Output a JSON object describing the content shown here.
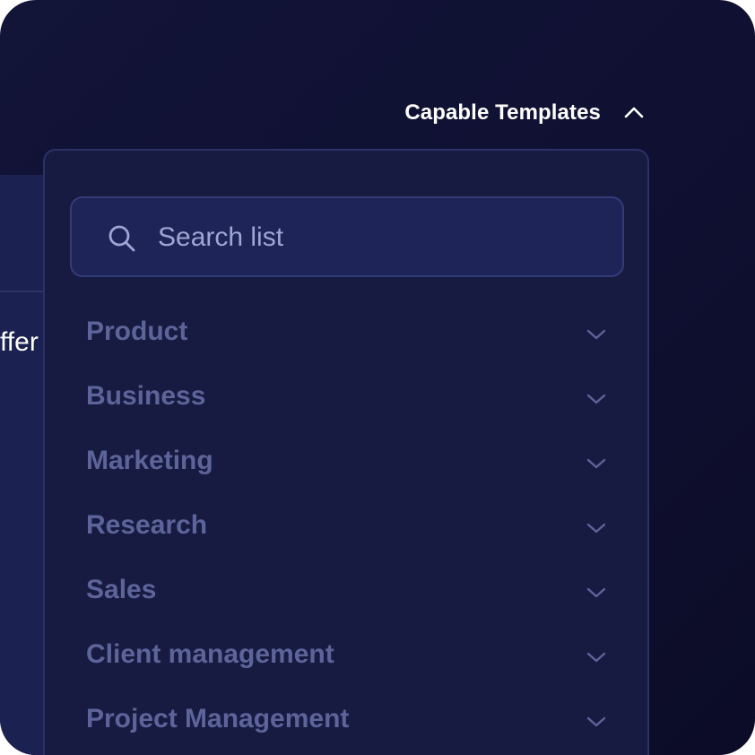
{
  "background": {
    "fragment_text": "ffer"
  },
  "header": {
    "title": "Capable Templates",
    "toggle_icon": "chevron-up-icon"
  },
  "dropdown": {
    "search": {
      "placeholder": "Search list",
      "value": "",
      "icon": "search-icon"
    },
    "categories": [
      {
        "label": "Product",
        "icon": "chevron-down-icon"
      },
      {
        "label": "Business",
        "icon": "chevron-down-icon"
      },
      {
        "label": "Marketing",
        "icon": "chevron-down-icon"
      },
      {
        "label": "Research",
        "icon": "chevron-down-icon"
      },
      {
        "label": "Sales",
        "icon": "chevron-down-icon"
      },
      {
        "label": "Client management",
        "icon": "chevron-down-icon"
      },
      {
        "label": "Project Management",
        "icon": "chevron-down-icon"
      }
    ]
  },
  "colors": {
    "background": "#121438",
    "dropdown_bg": "#171b41",
    "search_bg": "#1e2457",
    "category_text": "#5d6499",
    "header_text": "#ffffff",
    "placeholder_text": "#9ea6d4"
  }
}
